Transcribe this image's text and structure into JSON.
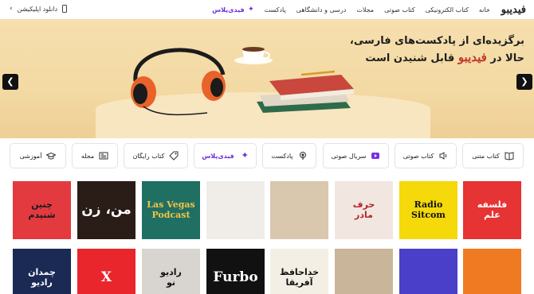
{
  "header": {
    "logo_text": "فیدیبو",
    "nav_items": [
      "خانه",
      "کتاب الکترونیکی",
      "کتاب صوتی",
      "مجلات",
      "درسی و دانشگاهی",
      "پادکست"
    ],
    "plus_label": "فیدی‌پلاس",
    "app_download": "دانلود اپلیکیشن"
  },
  "hero": {
    "line1": "برگزیده‌ای از پادکست‌های فارسی،",
    "line2_pre": "حالا در",
    "line2_brand": "فیدیبو",
    "line2_post": "قابل شنیدن است",
    "prev_icon": "chevron-left-icon",
    "next_icon": "chevron-right-icon"
  },
  "categories": [
    {
      "label": "کتاب متنی",
      "icon": "book-icon"
    },
    {
      "label": "کتاب صوتی",
      "icon": "speaker-icon"
    },
    {
      "label": "سریال صوتی",
      "icon": "play-series-icon"
    },
    {
      "label": "پادکست",
      "icon": "podcast-icon"
    },
    {
      "label": "فیدی‌پلاس",
      "icon": "plus-sparkle-icon"
    },
    {
      "label": "کتاب رایگان",
      "icon": "tag-icon"
    },
    {
      "label": "مجله",
      "icon": "newspaper-icon"
    },
    {
      "label": "آموزشی",
      "icon": "graduation-cap-icon"
    }
  ],
  "covers_row1": [
    {
      "text": "فلسفه\nعلم",
      "bg": "#e63333",
      "fg": "#ffffff"
    },
    {
      "text": "Radio\nSitcom",
      "bg": "#f5d90a",
      "fg": "#111111"
    },
    {
      "text": "حرف\nمادر",
      "bg": "#f2e6e0",
      "fg": "#b3262b"
    },
    {
      "text": "",
      "bg": "#d9c7ae",
      "fg": "#333333"
    },
    {
      "text": "",
      "bg": "#f0ede8",
      "fg": "#444444"
    },
    {
      "text": "Las Vegas\nPodcast",
      "bg": "#1f6f63",
      "fg": "#f5c542"
    },
    {
      "text": "من، زن",
      "bg": "#2a1c16",
      "fg": "#ffffff"
    },
    {
      "text": "چنین\nشنیدم",
      "bg": "#e23a3f",
      "fg": "#1a1a1a"
    }
  ],
  "covers_row2": [
    {
      "text": "",
      "bg": "#f07a22",
      "fg": "#ffffff"
    },
    {
      "text": "",
      "bg": "#4a3fc8",
      "fg": "#ffffff"
    },
    {
      "text": "",
      "bg": "#c9b59a",
      "fg": "#222222"
    },
    {
      "text": "خداحافظ\nآفریقا",
      "bg": "#f4efe4",
      "fg": "#111111"
    },
    {
      "text": "Furbo",
      "bg": "#111111",
      "fg": "#ffffff"
    },
    {
      "text": "رادیو\nنو",
      "bg": "#d8d4cf",
      "fg": "#111111"
    },
    {
      "text": "X",
      "bg": "#e8262c",
      "fg": "#ffffff"
    },
    {
      "text": "چمدان\nرادیو",
      "bg": "#1a2a55",
      "fg": "#ffffff"
    }
  ]
}
